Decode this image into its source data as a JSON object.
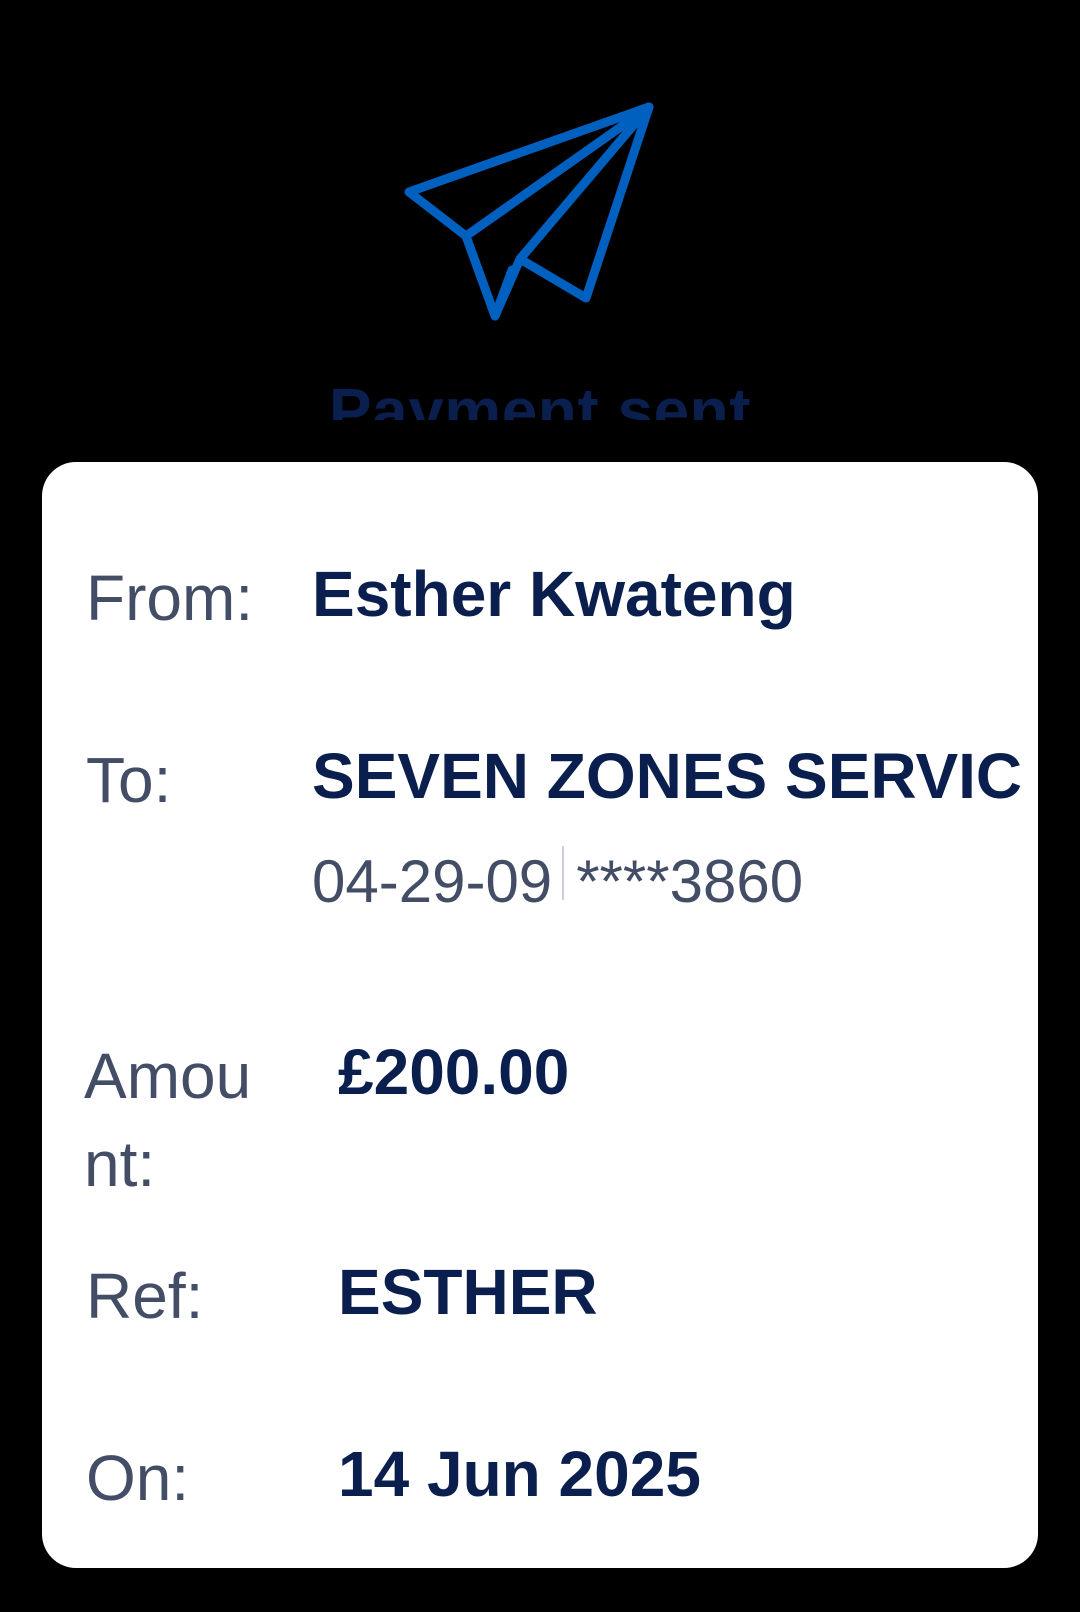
{
  "header": {
    "icon": "paper-plane-icon",
    "icon_color": "#0060c0",
    "title": "Payment sent"
  },
  "details": {
    "from_label": "From:",
    "from_value": "Esther Kwateng",
    "to_label": "To:",
    "to_value": "SEVEN ZONES SERVIC",
    "sort_code": "04-29-09",
    "account_masked": "****3860",
    "amount_label": "Amount:",
    "amount_value": "£200.00",
    "ref_label": "Ref:",
    "ref_value": "ESTHER",
    "on_label": "On:",
    "on_value": "14 Jun 2025"
  },
  "colors": {
    "background": "#000000",
    "card": "#ffffff",
    "label": "#434d66",
    "value": "#0a1f4e"
  }
}
